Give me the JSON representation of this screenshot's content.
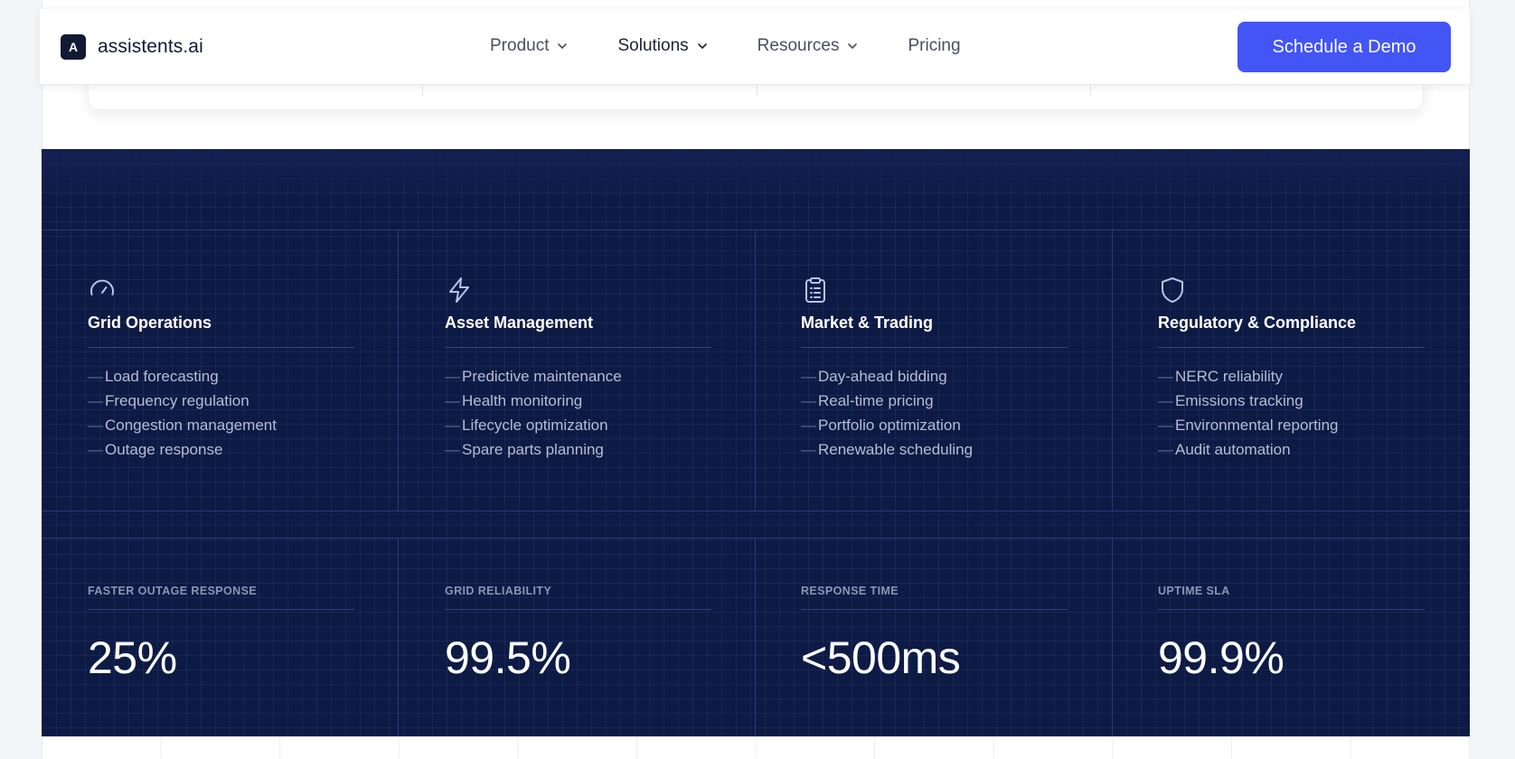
{
  "nav": {
    "logo_letter": "A",
    "logo_text": "assistents.ai",
    "links": [
      {
        "label": "Product",
        "has_dropdown": true
      },
      {
        "label": "Solutions",
        "has_dropdown": true
      },
      {
        "label": "Resources",
        "has_dropdown": true
      },
      {
        "label": "Pricing",
        "has_dropdown": false
      }
    ],
    "cta": "Schedule a Demo"
  },
  "colors": {
    "accent": "#4355f5",
    "dark_section": "#0d1a44",
    "logo_bg": "#121a33"
  },
  "capabilities": [
    {
      "icon": "gauge-icon",
      "title": "Grid Operations",
      "items": [
        "Load forecasting",
        "Frequency regulation",
        "Congestion management",
        "Outage response"
      ]
    },
    {
      "icon": "lightning-icon",
      "title": "Asset Management",
      "items": [
        "Predictive maintenance",
        "Health monitoring",
        "Lifecycle optimization",
        "Spare parts planning"
      ]
    },
    {
      "icon": "clipboard-icon",
      "title": "Market & Trading",
      "items": [
        "Day-ahead bidding",
        "Real-time pricing",
        "Portfolio optimization",
        "Renewable scheduling"
      ]
    },
    {
      "icon": "shield-icon",
      "title": "Regulatory & Compliance",
      "items": [
        "NERC reliability",
        "Emissions tracking",
        "Environmental reporting",
        "Audit automation"
      ]
    }
  ],
  "list_dash": "—",
  "metrics": [
    {
      "label": "FASTER OUTAGE RESPONSE",
      "value": "25%"
    },
    {
      "label": "GRID RELIABILITY",
      "value": "99.5%"
    },
    {
      "label": "RESPONSE TIME",
      "value": "<500ms"
    },
    {
      "label": "UPTIME SLA",
      "value": "99.9%"
    }
  ]
}
